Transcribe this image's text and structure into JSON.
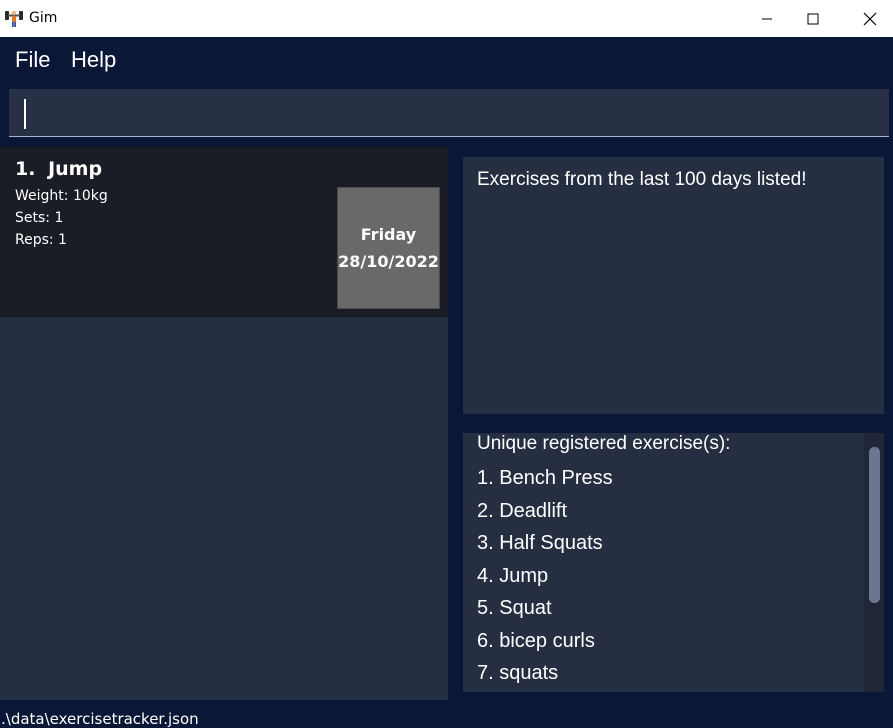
{
  "window": {
    "title": "Gim",
    "icon": "dumbbell-icon"
  },
  "menu": {
    "file_label": "File",
    "help_label": "Help"
  },
  "command": {
    "value": ""
  },
  "exercise_cards": [
    {
      "index": "1.",
      "name": "Jump",
      "weight": "Weight: 10kg",
      "sets": "Sets: 1",
      "reps": "Reps: 1",
      "day": "Friday",
      "date": "28/10/2022"
    }
  ],
  "result": {
    "message": "Exercises from the last 100 days listed!"
  },
  "exercise_list": {
    "heading": "Unique registered exercise(s):",
    "items": [
      "1. Bench Press",
      "2. Deadlift",
      "3. Half Squats",
      "4. Jump",
      "5. Squat",
      "6. bicep curls",
      "7. squats"
    ]
  },
  "status": {
    "path": ".\\data\\exercisetracker.json"
  },
  "colors": {
    "background": "#0b1736",
    "panel": "#262f42",
    "card": "#1b1d26",
    "date_box": "#696969"
  }
}
